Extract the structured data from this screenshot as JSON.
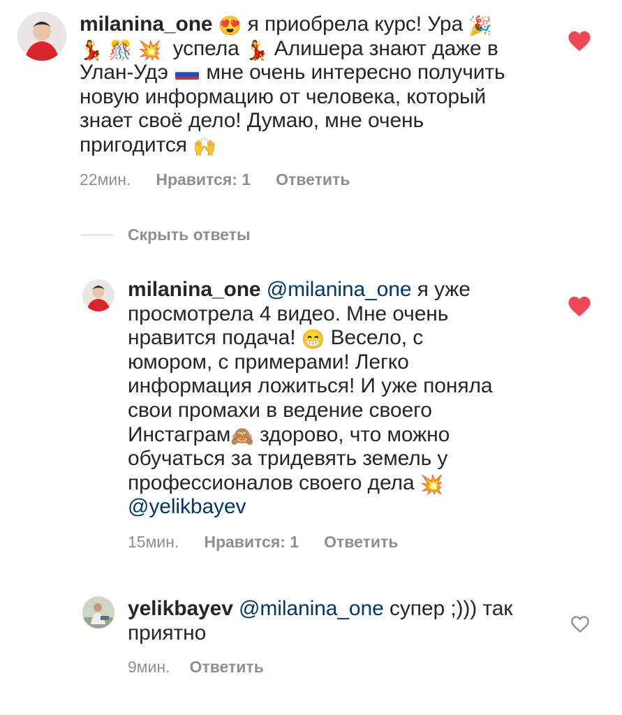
{
  "comments": [
    {
      "username": "milanina_one",
      "text_parts": [
        "я приобрела курс! Ура",
        "успела",
        "Алишера знают даже в",
        "Улан-Удэ",
        "мне очень интересно получить",
        "новую информацию от человека, который",
        "знает своё дело! Думаю, мне очень",
        "пригодится"
      ],
      "time": "22мин.",
      "likes": "Нравится: 1",
      "reply": "Ответить",
      "liked": true
    }
  ],
  "hide_replies": "Скрыть ответы",
  "replies": [
    {
      "username": "milanina_one",
      "mention": "@milanina_one",
      "text_parts": [
        "я уже",
        "просмотрела 4 видео. Мне очень",
        "нравится подача!",
        "Весело, с",
        "юмором, с примерами! Легко",
        "информация ложиться! И уже поняла",
        "свои промахи в ведение своего",
        "Инстаграм",
        "здорово, что можно",
        "обучаться за тридевять земель у",
        "профессионалов своего дела"
      ],
      "mention2": "@yelikbayev",
      "time": "15мин.",
      "likes": "Нравится: 1",
      "reply": "Ответить",
      "liked": true
    },
    {
      "username": "yelikbayev",
      "mention": "@milanina_one",
      "text_parts": [
        "супер ;))) так",
        "приятно"
      ],
      "time": "9мин.",
      "reply": "Ответить",
      "liked": false
    }
  ],
  "emojis": {
    "heart_eyes": "😍",
    "party": "🎉",
    "dancer": "💃",
    "confetti": "🎊",
    "collision": "💥",
    "grin": "😁",
    "monkey": "🙈",
    "raised_hands": "🙌"
  },
  "colors": {
    "heart_active": "#ed4956",
    "meta_gray": "#8e8e8e",
    "mention_blue": "#00376b"
  }
}
